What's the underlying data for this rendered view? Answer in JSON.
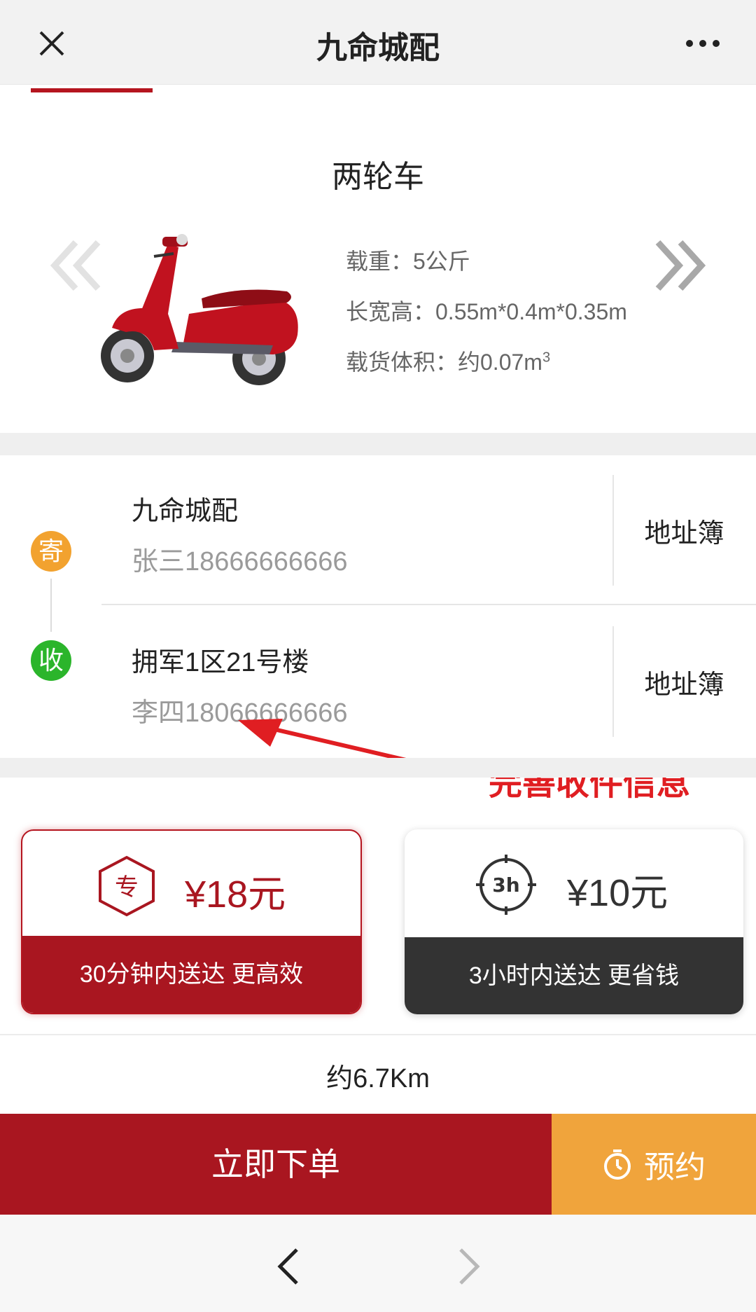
{
  "header": {
    "title": "九命城配",
    "close_icon": "close-icon",
    "more_icon": "more-icon"
  },
  "vehicle": {
    "type": "两轮车",
    "specs": {
      "load": "载重：5公斤",
      "dimensions": "长宽高：0.55m*0.4m*0.35m",
      "volume": "载货体积：约0.07m",
      "volume_sup": "3"
    },
    "scooter_brand_text": "九命城配"
  },
  "sender": {
    "badge": "寄",
    "name": "九命城配",
    "contact": "张三18666666666",
    "address_book": "地址簿"
  },
  "receiver": {
    "badge": "收",
    "name": "拥军1区21号楼",
    "contact": "李四18066666666",
    "address_book": "地址簿"
  },
  "annotation": {
    "text": "完善收件信息"
  },
  "options": [
    {
      "icon_text": "专",
      "price": "¥18元",
      "desc": "30分钟内送达  更高效",
      "selected": true
    },
    {
      "icon_text": "3h",
      "price": "¥10元",
      "desc": "3小时内送达  更省钱",
      "selected": false
    }
  ],
  "distance": "约6.7Km",
  "actions": {
    "order": "立即下单",
    "reserve": "预约"
  },
  "colors": {
    "brand_red": "#a91620",
    "reserve_orange": "#f0a43c",
    "send_badge": "#f2a22f",
    "receive_badge": "#2bb52b",
    "annotation_red": "#e01e22"
  }
}
